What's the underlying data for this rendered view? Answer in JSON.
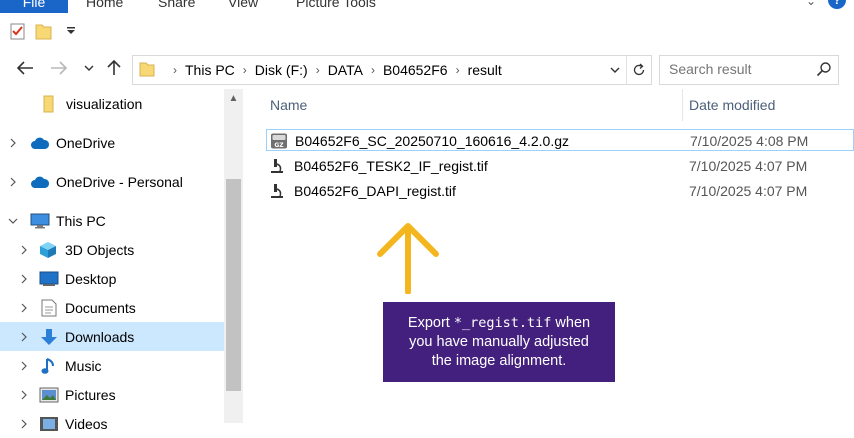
{
  "ribbon": {
    "tabs": [
      "File",
      "Home",
      "Share",
      "View",
      "Picture Tools"
    ]
  },
  "navigation": {
    "back_icon": "back-arrow-icon",
    "forward_icon": "forward-arrow-icon",
    "recent_icon": "chevron-down-icon",
    "up_icon": "up-arrow-icon"
  },
  "address": {
    "crumbs": [
      "This PC",
      "Disk (F:)",
      "DATA",
      "B04652F6",
      "result"
    ]
  },
  "search": {
    "placeholder": "Search result"
  },
  "sidebar": {
    "items": [
      {
        "label": "visualization",
        "icon": "folder-icon"
      },
      {
        "label": "OneDrive",
        "icon": "cloud-icon"
      },
      {
        "label": "OneDrive - Personal",
        "icon": "cloud-icon"
      },
      {
        "label": "This PC",
        "icon": "computer-icon"
      },
      {
        "label": "3D Objects",
        "icon": "cube-icon"
      },
      {
        "label": "Desktop",
        "icon": "desktop-icon"
      },
      {
        "label": "Documents",
        "icon": "document-icon"
      },
      {
        "label": "Downloads",
        "icon": "download-icon"
      },
      {
        "label": "Music",
        "icon": "music-icon"
      },
      {
        "label": "Pictures",
        "icon": "pictures-icon"
      },
      {
        "label": "Videos",
        "icon": "video-icon"
      }
    ]
  },
  "file_list": {
    "columns": [
      "Name",
      "Date modified"
    ],
    "files": [
      {
        "name": "B04652F6_SC_20250710_160616_4.2.0.gz",
        "date": "7/10/2025 4:08 PM",
        "icon": "gz-archive-icon"
      },
      {
        "name": "B04652F6_TESK2_IF_regist.tif",
        "date": "7/10/2025 4:07 PM",
        "icon": "microscope-icon"
      },
      {
        "name": "B04652F6_DAPI_regist.tif",
        "date": "7/10/2025 4:07 PM",
        "icon": "microscope-icon"
      }
    ]
  },
  "callout": {
    "line1_prefix": "Export ",
    "line1_code": "*_regist.tif",
    "line1_suffix": " when",
    "line2": "you have manually adjusted",
    "line3": "the image alignment."
  },
  "colors": {
    "accent": "#1a66c8",
    "callout_bg": "#44207e",
    "arrow": "#f3b61e",
    "selection": "#cce8ff"
  }
}
